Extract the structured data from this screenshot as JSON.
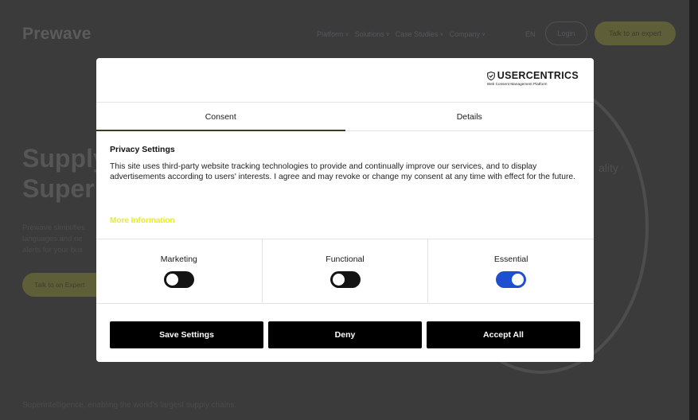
{
  "background": {
    "logo": "Prewave",
    "nav": [
      {
        "label": "Platform"
      },
      {
        "label": "Solutions"
      },
      {
        "label": "Case Studies"
      },
      {
        "label": "Company"
      }
    ],
    "lang": "EN",
    "login": "Login",
    "talk_to_expert": "Talk to an expert",
    "hero_line1": "Supply",
    "hero_line2": "Super",
    "hero_body": "Prewave simplifies languages and ne alerts for your bus",
    "hero_button": "Talk to an Expert",
    "side_word": "ality",
    "tagline": "Superintelligence, enabling the world's largest supply chains."
  },
  "modal": {
    "brand_name": "USERCENTRICS",
    "brand_sub": "Web Consent Management Platform",
    "tabs": [
      {
        "label": "Consent",
        "active": true
      },
      {
        "label": "Details",
        "active": false
      }
    ],
    "heading": "Privacy Settings",
    "body": "This site uses third-party website tracking technologies to provide and continually improve our services, and to display advertisements according to users' interests. I agree and may revoke or change my consent at any time with effect for the future.",
    "more_info": "More Information",
    "toggles": [
      {
        "label": "Marketing",
        "on": false
      },
      {
        "label": "Functional",
        "on": false
      },
      {
        "label": "Essential",
        "on": true
      }
    ],
    "buttons": {
      "save": "Save Settings",
      "deny": "Deny",
      "accept": "Accept All"
    }
  },
  "colors": {
    "overlay_bg": "#3a3b3a",
    "accent_yellow": "#e6ef19",
    "toggle_on": "#1f4fd1",
    "button_bg": "#000000"
  }
}
